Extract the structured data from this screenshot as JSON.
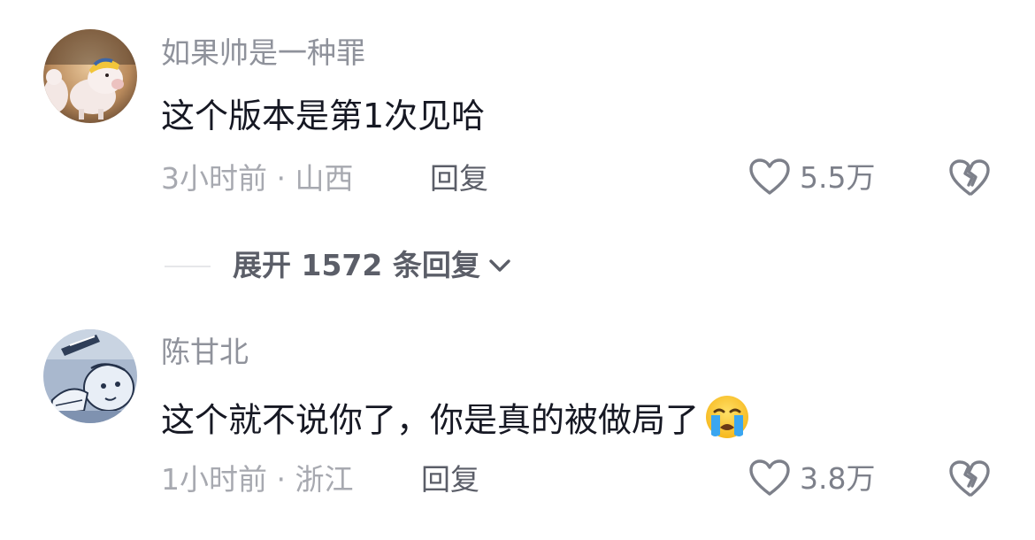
{
  "comments": [
    {
      "username": "如果帅是一种罪",
      "text": "这个版本是第1次见哈",
      "time_location": "3小时前 · 山西",
      "reply_label": "回复",
      "likes": "5.5万",
      "avatar_icon": "pig-avatar"
    },
    {
      "username": "陈甘北",
      "text": "这个就不说你了，你是真的被做局了",
      "emoji": "crying-face-emoji",
      "time_location": "1小时前 · 浙江",
      "reply_label": "回复",
      "likes": "3.8万",
      "avatar_icon": "sketch-character-avatar"
    }
  ],
  "expand_replies": {
    "label": "展开 1572 条回复",
    "icon": "chevron-down-icon"
  },
  "colors": {
    "username": "#8f929b",
    "content": "#161823",
    "meta": "#a7a9b0",
    "reply": "#5b5e68",
    "icon": "#7d808a"
  }
}
